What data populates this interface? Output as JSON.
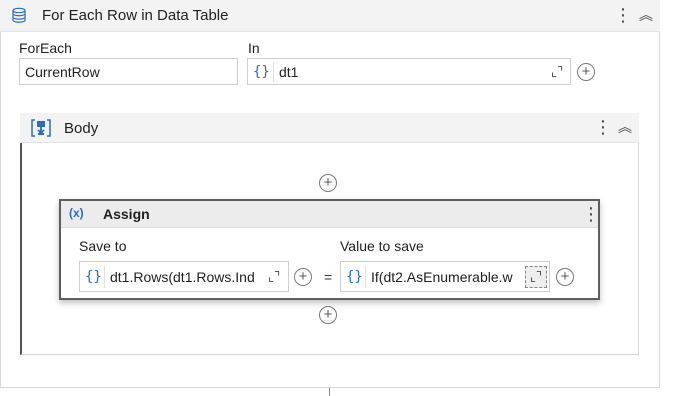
{
  "outer": {
    "title": "For Each Row in Data Table"
  },
  "foreach": {
    "label": "ForEach",
    "value": "CurrentRow"
  },
  "in": {
    "label": "In",
    "brace": "{}",
    "value": "dt1"
  },
  "body": {
    "title": "Body"
  },
  "assign": {
    "title": "Assign",
    "save_to": {
      "label": "Save to",
      "brace": "{}",
      "value": "dt1.Rows(dt1.Rows.Ind"
    },
    "equals": "=",
    "value_to_save": {
      "label": "Value to save",
      "brace": "{}",
      "value": "If(dt2.AsEnumerable.w"
    }
  },
  "icons": {
    "kebab": "⋮",
    "collapse": "︽",
    "plus": "+",
    "expand": "⌞⌝",
    "assign_icon": "(x)"
  },
  "colors": {
    "brace": "#2b6cc4",
    "body_icon": "#2b6cc4"
  }
}
